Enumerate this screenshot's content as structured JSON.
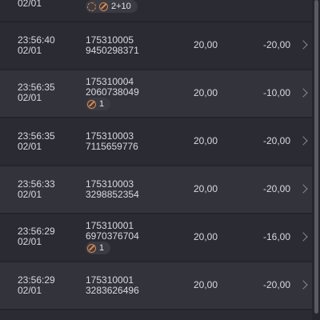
{
  "top_partial": {
    "date": "02/01",
    "pill_count": "2+10"
  },
  "rows": [
    {
      "time": "23:56:40",
      "date": "02/01",
      "ref_top": "175310005",
      "ref_bottom": "9450298371",
      "amount": "20,00",
      "delta": "-20,00",
      "pill": ""
    },
    {
      "time": "23:56:35",
      "date": "02/01",
      "ref_top": "175310004",
      "ref_bottom": "2060738049",
      "amount": "20,00",
      "delta": "-10,00",
      "pill": "1"
    },
    {
      "time": "23:56:35",
      "date": "02/01",
      "ref_top": "175310003",
      "ref_bottom": "7115659776",
      "amount": "20,00",
      "delta": "-20,00",
      "pill": ""
    },
    {
      "time": "23:56:33",
      "date": "02/01",
      "ref_top": "175310003",
      "ref_bottom": "3298852354",
      "amount": "20,00",
      "delta": "-20,00",
      "pill": ""
    },
    {
      "time": "23:56:29",
      "date": "02/01",
      "ref_top": "175310001",
      "ref_bottom": "6970376704",
      "amount": "20,00",
      "delta": "-16,00",
      "pill": "1"
    },
    {
      "time": "23:56:29",
      "date": "02/01",
      "ref_top": "175310001",
      "ref_bottom": "3283626496",
      "amount": "20,00",
      "delta": "-20,00",
      "pill": ""
    }
  ],
  "icons": {
    "chevron": "chevron-right-icon",
    "pill_icon": "no-sign-icon",
    "refresh": "refresh-icon"
  },
  "colors": {
    "background": "#2b2b33",
    "row_alt": "#33333c",
    "accent_orange": "#d98a4a",
    "text": "#d9d9de"
  }
}
